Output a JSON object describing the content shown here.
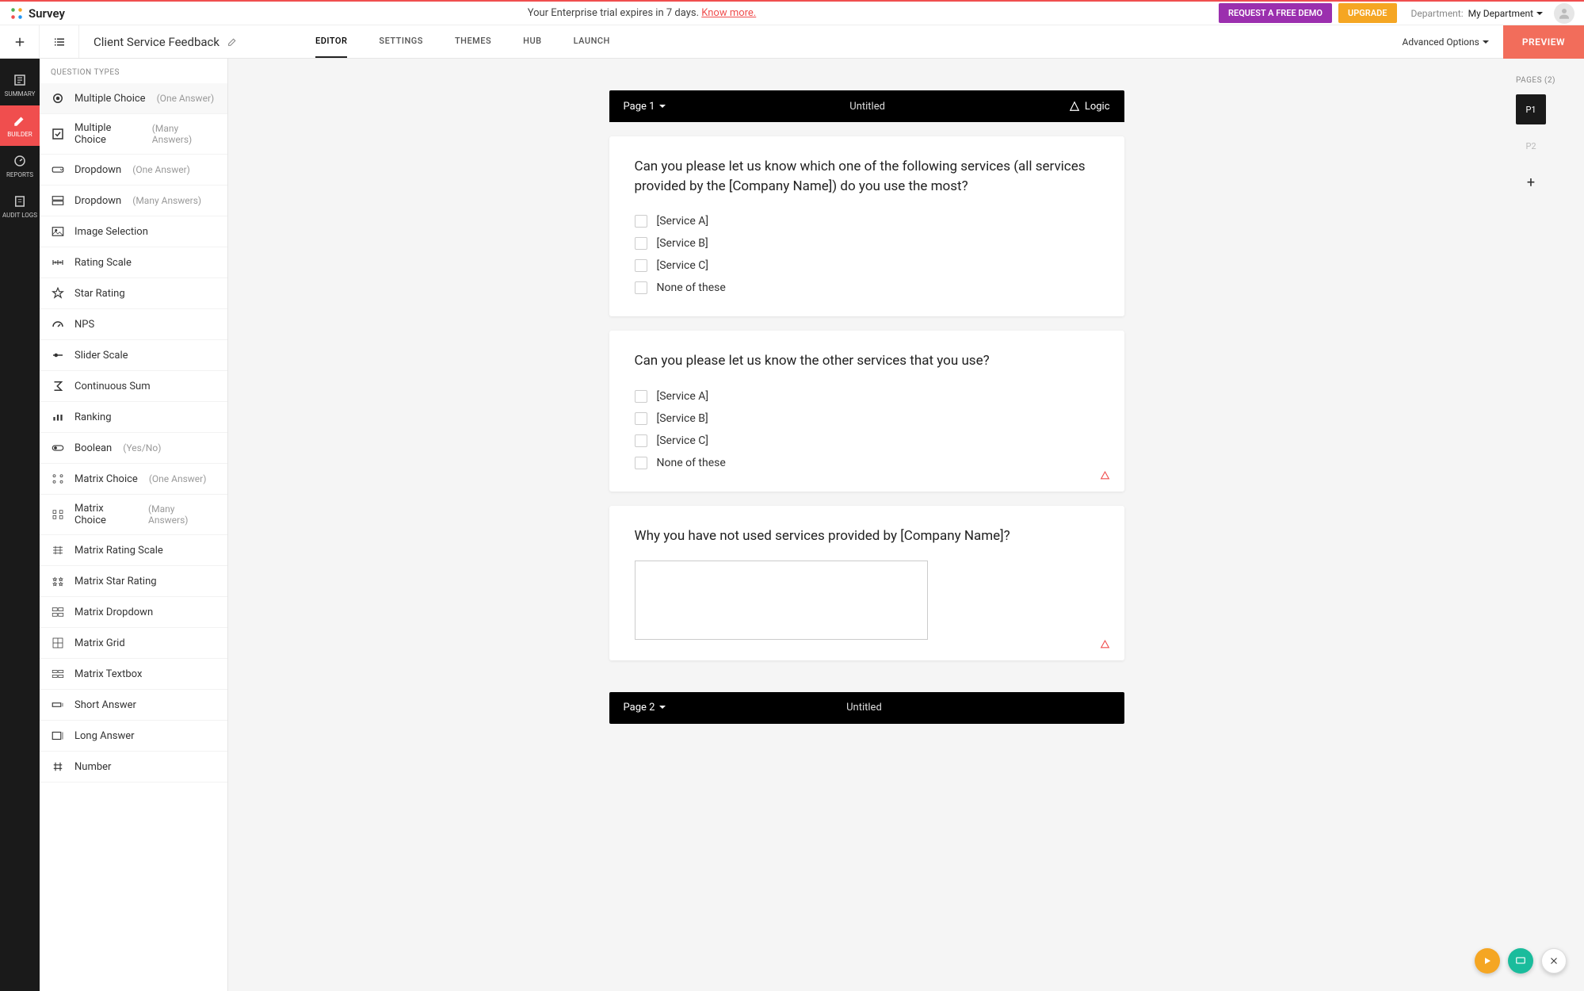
{
  "trial": {
    "text": "Your Enterprise trial expires in 7 days. ",
    "link": "Know more."
  },
  "brand": {
    "name": "Survey"
  },
  "header": {
    "demo_btn": "REQUEST A FREE DEMO",
    "upgrade_btn": "UPGRADE",
    "dept_label": "Department:",
    "dept_value": "My Department"
  },
  "toolbar": {
    "survey_title": "Client Service Feedback",
    "tabs": [
      "EDITOR",
      "SETTINGS",
      "THEMES",
      "HUB",
      "LAUNCH"
    ],
    "active_tab": 0,
    "advanced": "Advanced Options",
    "preview": "PREVIEW"
  },
  "rail": {
    "items": [
      "SUMMARY",
      "BUILDER",
      "REPORTS",
      "AUDIT LOGS"
    ],
    "active": 1
  },
  "sidebar": {
    "header": "QUESTION TYPES",
    "items": [
      {
        "label": "Multiple Choice",
        "sub": "(One Answer)",
        "ico": "radio",
        "selected": true
      },
      {
        "label": "Multiple Choice",
        "sub": "(Many Answers)",
        "ico": "check"
      },
      {
        "label": "Dropdown",
        "sub": "(One Answer)",
        "ico": "dd"
      },
      {
        "label": "Dropdown",
        "sub": "(Many Answers)",
        "ico": "ddm"
      },
      {
        "label": "Image Selection",
        "sub": "",
        "ico": "img"
      },
      {
        "label": "Rating Scale",
        "sub": "",
        "ico": "scale"
      },
      {
        "label": "Star Rating",
        "sub": "",
        "ico": "star"
      },
      {
        "label": "NPS",
        "sub": "",
        "ico": "nps"
      },
      {
        "label": "Slider Scale",
        "sub": "",
        "ico": "slider"
      },
      {
        "label": "Continuous Sum",
        "sub": "",
        "ico": "sum"
      },
      {
        "label": "Ranking",
        "sub": "",
        "ico": "rank"
      },
      {
        "label": "Boolean",
        "sub": "(Yes/No)",
        "ico": "bool"
      },
      {
        "label": "Matrix Choice",
        "sub": "(One Answer)",
        "ico": "mc1"
      },
      {
        "label": "Matrix Choice",
        "sub": "(Many Answers)",
        "ico": "mcm"
      },
      {
        "label": "Matrix Rating Scale",
        "sub": "",
        "ico": "mrs"
      },
      {
        "label": "Matrix Star Rating",
        "sub": "",
        "ico": "msr"
      },
      {
        "label": "Matrix Dropdown",
        "sub": "",
        "ico": "mdd"
      },
      {
        "label": "Matrix Grid",
        "sub": "",
        "ico": "mgrid"
      },
      {
        "label": "Matrix Textbox",
        "sub": "",
        "ico": "mtb"
      },
      {
        "label": "Short Answer",
        "sub": "",
        "ico": "short"
      },
      {
        "label": "Long Answer",
        "sub": "",
        "ico": "long"
      },
      {
        "label": "Number",
        "sub": "",
        "ico": "num"
      }
    ]
  },
  "canvas": {
    "page_label": "Page 1",
    "page_title": "Untitled",
    "logic_label": "Logic",
    "questions": [
      {
        "text": "Can you please let us know which one of the following services (all services provided by the [Company Name]) do you use the most?",
        "type": "check",
        "options": [
          "[Service A]",
          "[Service B]",
          "[Service C]",
          "None of these"
        ],
        "has_logic": false
      },
      {
        "text": "Can you please let us know the other services that you use?",
        "type": "check",
        "options": [
          "[Service A]",
          "[Service B]",
          "[Service C]",
          "None of these"
        ],
        "has_logic": true
      },
      {
        "text": "Why you have not used services provided by [Company Name]?",
        "type": "textarea",
        "options": [],
        "has_logic": true
      }
    ],
    "page2_label": "Page 2",
    "page2_title": "Untitled"
  },
  "pages_panel": {
    "header": "PAGES (2)",
    "pages": [
      "P1",
      "P2"
    ],
    "active": 0
  }
}
